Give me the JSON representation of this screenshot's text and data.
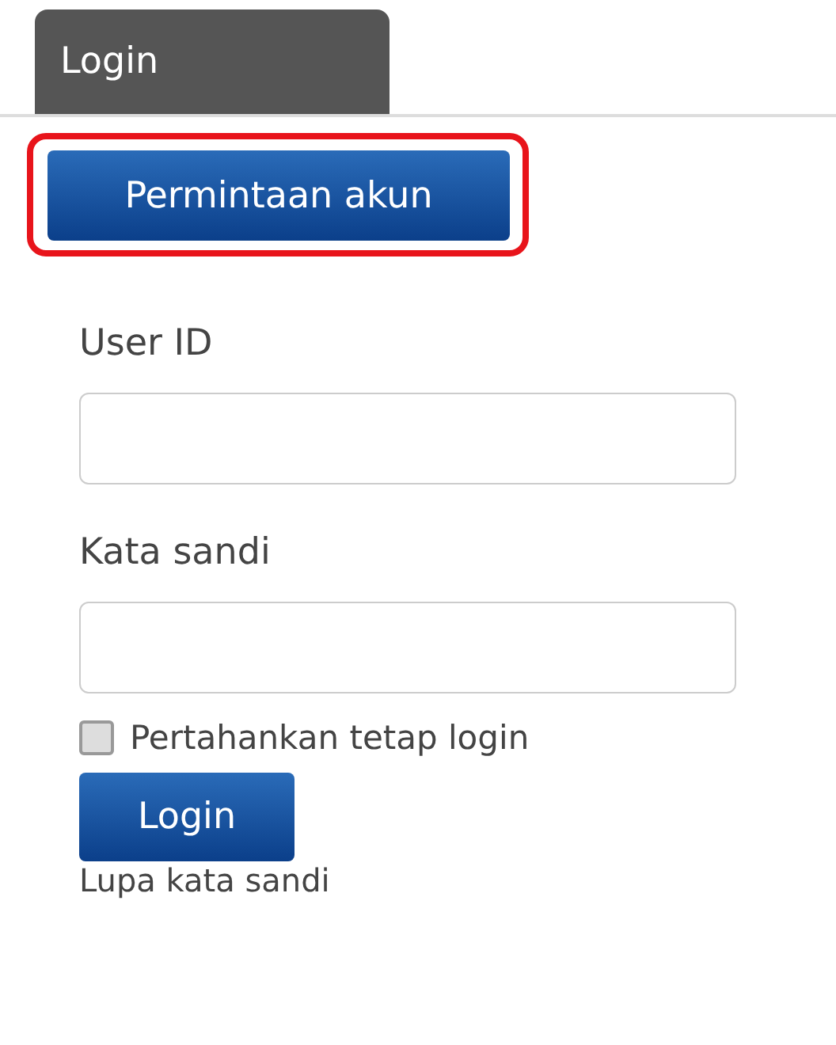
{
  "tab": {
    "label": "Login",
    "selected": true
  },
  "request_button": {
    "label": "Permintaan akun",
    "highlighted": true
  },
  "fields": [
    {
      "label": "User ID"
    },
    {
      "label": "Kata sandi"
    }
  ],
  "remember": {
    "label": "Pertahankan tetap login",
    "checked": false
  },
  "login_button": {
    "label": "Login"
  },
  "forgot_link": "Lupa kata sandi"
}
